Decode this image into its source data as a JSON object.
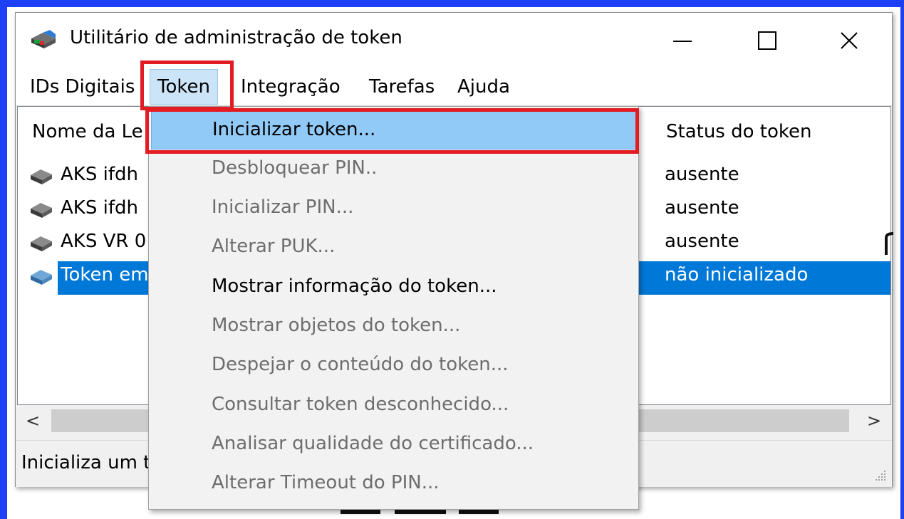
{
  "window": {
    "title": "Utilitário de administração de token"
  },
  "menubar": {
    "items": [
      "IDs Digitais",
      "Token",
      "Integração",
      "Tarefas",
      "Ajuda"
    ],
    "active": "Token"
  },
  "list": {
    "columns": {
      "name": "Nome da Le",
      "status": "Status do token"
    },
    "rows": [
      {
        "name": "AKS ifdh",
        "status": "ausente",
        "icon": "card-reader-icon"
      },
      {
        "name": "AKS ifdh",
        "status": "ausente",
        "icon": "card-reader-icon"
      },
      {
        "name": "AKS VR 0",
        "status": "ausente",
        "icon": "card-reader-icon"
      },
      {
        "name": "Token em",
        "status": "não inicializado",
        "icon": "token-icon",
        "selected": true
      }
    ]
  },
  "scrollbar": {
    "left_arrow": "<",
    "right_arrow": ">"
  },
  "statusbar": {
    "text": "Inicializa um t"
  },
  "token_menu": {
    "items": [
      {
        "label": "Inicializar token...",
        "enabled": true,
        "highlighted": true
      },
      {
        "label": "Desbloquear PIN..",
        "enabled": false
      },
      {
        "label": "Inicializar PIN...",
        "enabled": false
      },
      {
        "label": "Alterar PUK...",
        "enabled": false
      },
      {
        "label": "Mostrar informação do token...",
        "enabled": true
      },
      {
        "label": "Mostrar objetos do token...",
        "enabled": false
      },
      {
        "label": "Despejar o conteúdo do token...",
        "enabled": false
      },
      {
        "label": "Consultar token desconhecido...",
        "enabled": false
      },
      {
        "label": "Analisar qualidade do certificado...",
        "enabled": false
      },
      {
        "label": "Alterar Timeout do PIN...",
        "enabled": false
      }
    ]
  },
  "colors": {
    "frame_blue": "#1d3ff5",
    "selection": "#0078d7",
    "menu_highlight": "#91c9f7",
    "annotation_red": "#e31b23"
  }
}
